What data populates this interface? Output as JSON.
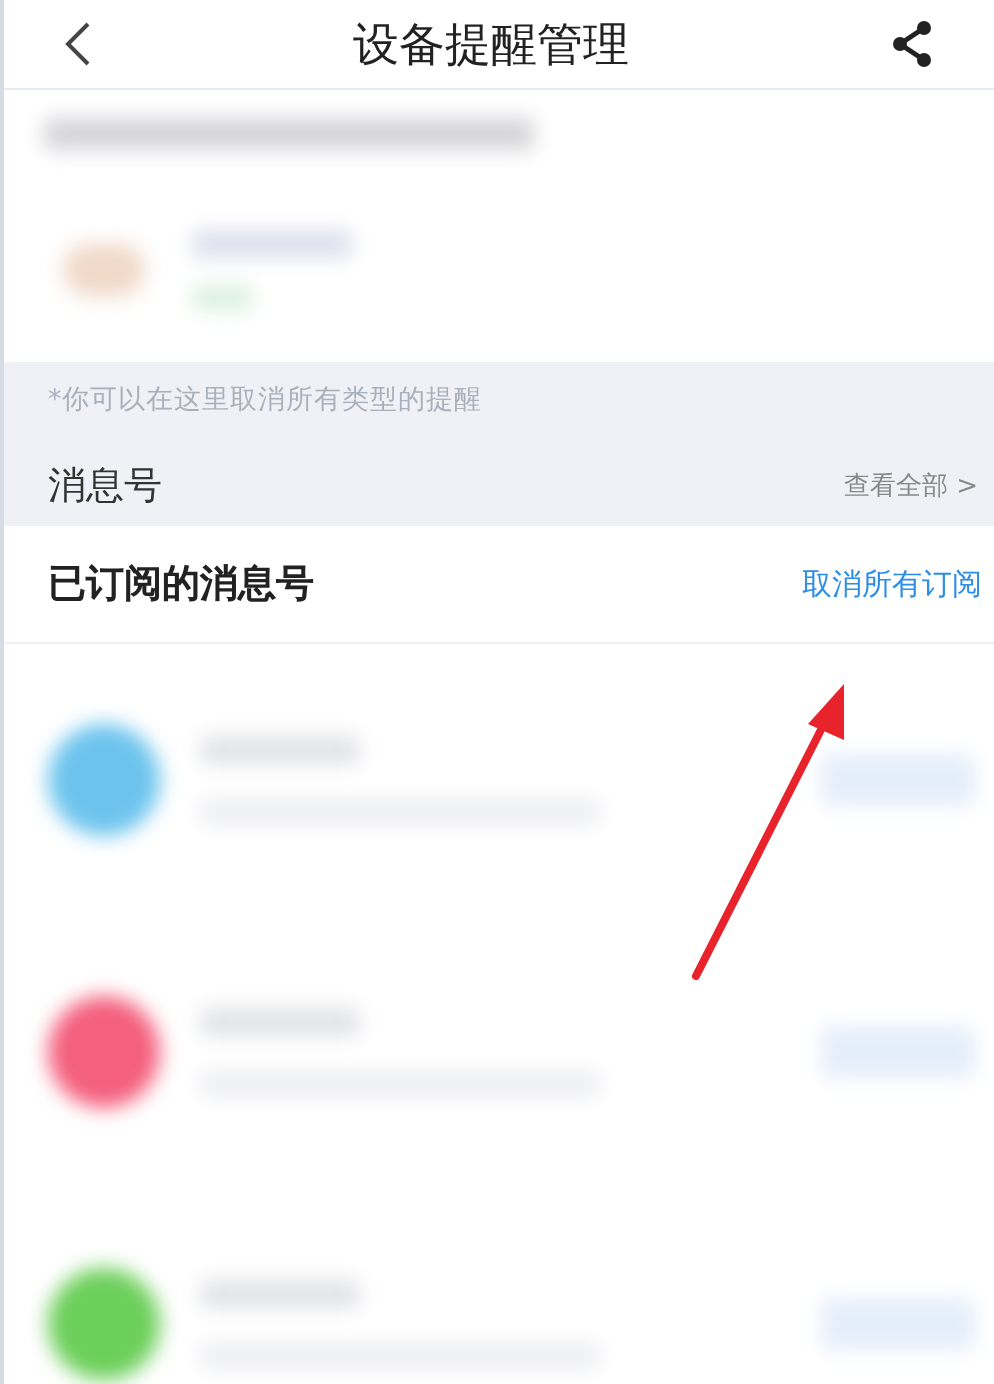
{
  "header": {
    "title": "设备提醒管理"
  },
  "device": {
    "kind": "blurred"
  },
  "note": "*你可以在这里取消所有类型的提醒",
  "section": {
    "title": "消息号",
    "link": "查看全部 >"
  },
  "subscribed": {
    "title": "已订阅的消息号",
    "action": "取消所有订阅"
  },
  "subscriptions": [
    {
      "color": "#6cc4ee"
    },
    {
      "color": "#f4607e"
    },
    {
      "color": "#6ccf5a"
    }
  ],
  "annotation": {
    "kind": "arrow",
    "color": "#e8232b"
  }
}
